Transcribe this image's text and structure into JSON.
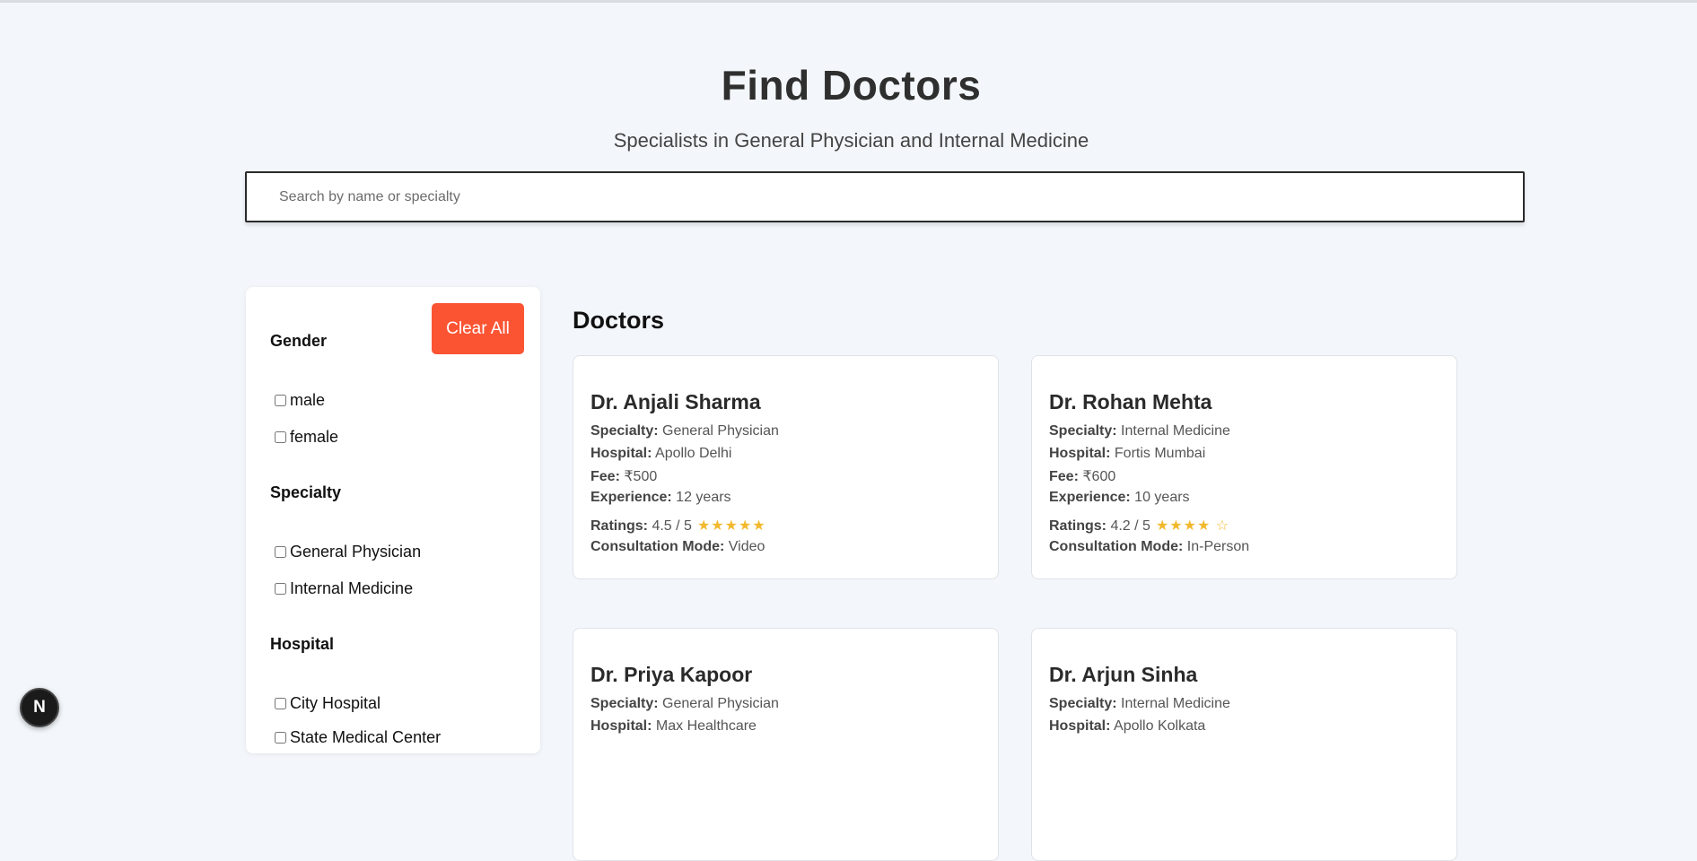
{
  "header": {
    "title": "Find Doctors",
    "subtitle": "Specialists in General Physician and Internal Medicine"
  },
  "search": {
    "placeholder": "Search by name or specialty",
    "value": ""
  },
  "filters": {
    "clear_label": "Clear All",
    "gender": {
      "heading": "Gender",
      "options": [
        "male",
        "female"
      ]
    },
    "specialty": {
      "heading": "Specialty",
      "options": [
        "General Physician",
        "Internal Medicine"
      ]
    },
    "hospital": {
      "heading": "Hospital",
      "options": [
        "City Hospital",
        "State Medical Center"
      ]
    }
  },
  "results": {
    "title": "Doctors",
    "labels": {
      "specialty": "Specialty:",
      "hospital": "Hospital:",
      "fee": "Fee:",
      "experience": "Experience:",
      "ratings": "Ratings:",
      "mode": "Consultation Mode:"
    },
    "doctors": [
      {
        "name": "Dr. Anjali Sharma",
        "specialty": "General Physician",
        "hospital": "Apollo Delhi",
        "fee": "₹500",
        "experience": "12 years",
        "rating": "4.5 / 5",
        "stars": "★★★★★",
        "mode": "Video"
      },
      {
        "name": "Dr. Rohan Mehta",
        "specialty": "Internal Medicine",
        "hospital": "Fortis Mumbai",
        "fee": "₹600",
        "experience": "10 years",
        "rating": "4.2 / 5",
        "stars": "★★★★ ☆",
        "mode": "In-Person"
      },
      {
        "name": "Dr. Priya Kapoor",
        "specialty": "General Physician",
        "hospital": "Max Healthcare"
      },
      {
        "name": "Dr. Arjun Sinha",
        "specialty": "Internal Medicine",
        "hospital": "Apollo Kolkata"
      }
    ]
  },
  "dev_badge": {
    "letter": "N"
  },
  "colors": {
    "accent": "#fb5433",
    "star": "#f2b92e",
    "background": "#f3f7fb"
  }
}
